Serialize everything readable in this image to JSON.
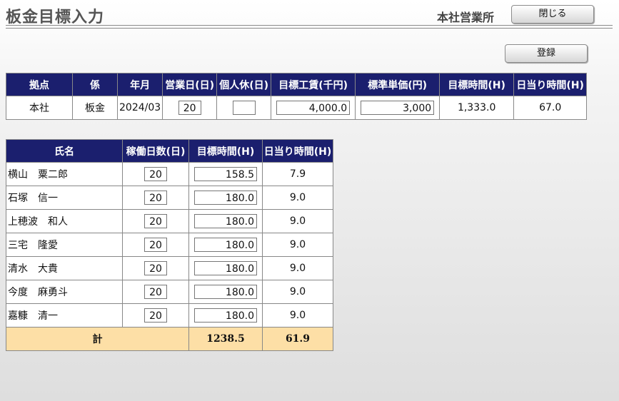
{
  "header": {
    "title": "板金目標入力",
    "office": "本社営業所",
    "close_label": "閉じる",
    "register_label": "登録"
  },
  "summary": {
    "headers": [
      "拠点",
      "係",
      "年月",
      "営業日(日)",
      "個人休(日)",
      "目標工賃(千円)",
      "標準単価(円)",
      "目標時間(H)",
      "日当り時間(H)"
    ],
    "row": {
      "location": "本社",
      "section": "板金",
      "year_month": "2024/03",
      "business_days": "20",
      "personal_leave": "",
      "target_wage": "4,000.0",
      "standard_unit_price": "3,000",
      "target_hours": "1,333.0",
      "daily_hours": "67.0"
    }
  },
  "staff": {
    "headers": [
      "氏名",
      "稼働日数(日)",
      "目標時間(H)",
      "日当り時間(H)"
    ],
    "rows": [
      {
        "name": "横山　粟二郎",
        "days": "20",
        "target_hours": "158.5",
        "daily_hours": "7.9"
      },
      {
        "name": "石塚　信一",
        "days": "20",
        "target_hours": "180.0",
        "daily_hours": "9.0"
      },
      {
        "name": "上穂波　和人",
        "days": "20",
        "target_hours": "180.0",
        "daily_hours": "9.0"
      },
      {
        "name": "三宅　隆愛",
        "days": "20",
        "target_hours": "180.0",
        "daily_hours": "9.0"
      },
      {
        "name": "清水　大貴",
        "days": "20",
        "target_hours": "180.0",
        "daily_hours": "9.0"
      },
      {
        "name": "今度　麻勇斗",
        "days": "20",
        "target_hours": "180.0",
        "daily_hours": "9.0"
      },
      {
        "name": "嘉糠　清一",
        "days": "20",
        "target_hours": "180.0",
        "daily_hours": "9.0"
      }
    ],
    "total": {
      "label": "計",
      "target_hours": "1238.5",
      "daily_hours": "61.9"
    }
  },
  "colors": {
    "header_bg": "#1b1f6e",
    "total_bg": "#fddfa6"
  }
}
